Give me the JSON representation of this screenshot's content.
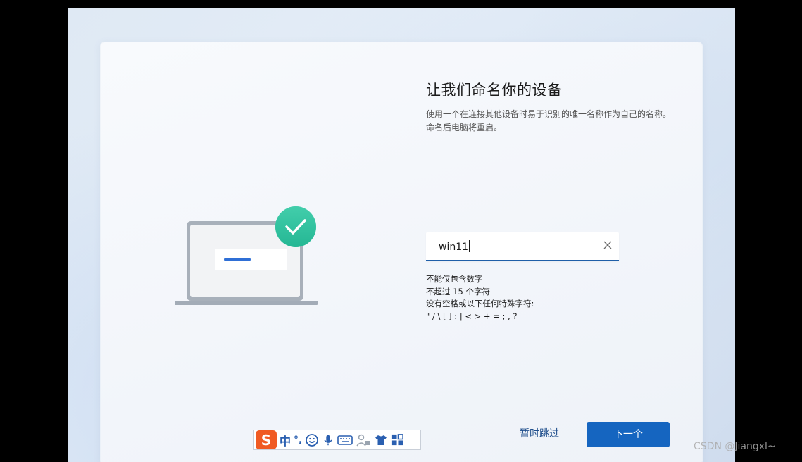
{
  "page": {
    "title": "让我们命名你的设备",
    "description": "使用一个在连接其他设备时易于识别的唯一名称作为自己的名称。命名后电脑将重启。"
  },
  "name_input": {
    "value": "win11",
    "clear_icon": "close-icon"
  },
  "rules": [
    "不能仅包含数字",
    "不超过 15 个字符",
    "没有空格或以下任何特殊字符:",
    "\" / \\ [ ] : | < > + = ; , ?"
  ],
  "buttons": {
    "skip_label": "暂时跳过",
    "next_label": "下一个"
  },
  "ime_toolbar": {
    "logo": "S",
    "mode": "中",
    "punct": "°,",
    "icons": [
      "emoji-icon",
      "microphone-icon",
      "keyboard-icon",
      "user-tools-icon",
      "shirt-icon",
      "grid-icon"
    ]
  },
  "watermark": "CSDN @Jiangxl~",
  "colors": {
    "accent": "#1565c0",
    "check_green": "#2ec4a0",
    "ime_orange": "#f05a22"
  }
}
